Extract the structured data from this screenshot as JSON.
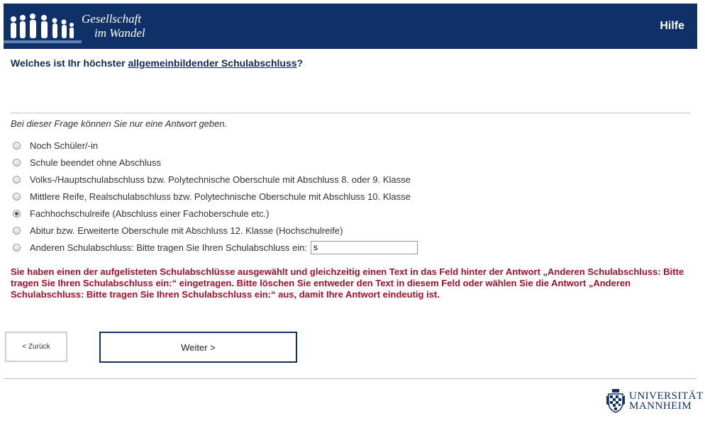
{
  "header": {
    "logo_line1": "Gesellschaft",
    "logo_line2": "im Wandel",
    "help_label": "Hilfe"
  },
  "question": {
    "prefix": "Welches ist Ihr höchster ",
    "underlined": "allgemeinbildender Schulabschluss",
    "suffix": "?"
  },
  "hint": "Bei dieser Frage können Sie nur eine Antwort geben.",
  "options": [
    {
      "label": "Noch Schüler/-in",
      "checked": false
    },
    {
      "label": "Schule beendet ohne Abschluss",
      "checked": false
    },
    {
      "label": "Volks-/Hauptschulabschluss bzw. Polytechnische Oberschule mit Abschluss 8. oder 9. Klasse",
      "checked": false
    },
    {
      "label": "Mittlere Reife, Realschulabschluss bzw. Polytechnische Oberschule mit Abschluss 10. Klasse",
      "checked": false
    },
    {
      "label": "Fachhochschulreife (Abschluss einer Fachoberschule etc.)",
      "checked": true
    },
    {
      "label": "Abitur bzw. Erweiterte Oberschule mit Abschluss 12. Klasse (Hochschulreife)",
      "checked": false
    },
    {
      "label": "Anderen Schulabschluss: Bitte tragen Sie Ihren Schulabschluss ein:",
      "checked": false
    }
  ],
  "other_value": "s",
  "error": "Sie haben einen der aufgelisteten Schulabschlüsse ausgewählt und gleichzeitig einen Text in das Feld hinter der Antwort „Anderen Schulabschluss: Bitte tragen Sie Ihren Schulabschluss ein:“ eingetragen. Bitte löschen Sie entweder den Text in diesem Feld oder wählen Sie die Antwort „Anderen Schulabschluss: Bitte tragen Sie Ihren Schulabschluss ein:“ aus, damit Ihre Antwort eindeutig ist.",
  "nav": {
    "back_label": "< Zurück",
    "next_label": "Weiter >"
  },
  "footer": {
    "uni_line1": "UNIVERSITÄT",
    "uni_line2": "MANNHEIM"
  },
  "colors": {
    "brand": "#0f3168",
    "error": "#a0102a"
  }
}
